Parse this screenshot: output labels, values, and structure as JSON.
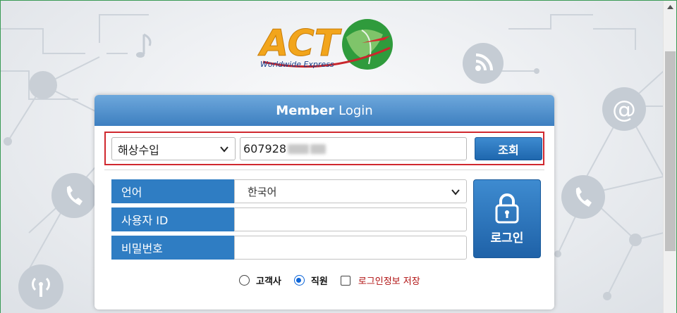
{
  "logo": {
    "brand_letters": "ACT",
    "tagline": "Worldwide Express"
  },
  "login": {
    "title_strong": "Member",
    "title_rest": "Login"
  },
  "search": {
    "cargo_type": "해상수입",
    "tracking_number_visible": "607928",
    "search_button": "조회"
  },
  "form": {
    "language_label": "언어",
    "language_value": "한국어",
    "user_id_label": "사용자 ID",
    "user_id_value": "",
    "password_label": "비밀번호",
    "password_value": "",
    "login_button": "로그인"
  },
  "options": {
    "customer_label": "고객사",
    "staff_label": "직원",
    "selected": "직원",
    "save_login_label": "로그인정보 저장",
    "save_login_checked": false
  },
  "colors": {
    "header_blue": "#3d7fc0",
    "label_blue": "#2f7dc3",
    "highlight_red": "#d0282f",
    "save_text_red": "#b01010"
  },
  "icons": [
    "wifi-icon",
    "at-icon",
    "phone-icon",
    "antenna-icon",
    "music-note-icon",
    "lock-icon",
    "chevron-down-icon"
  ]
}
